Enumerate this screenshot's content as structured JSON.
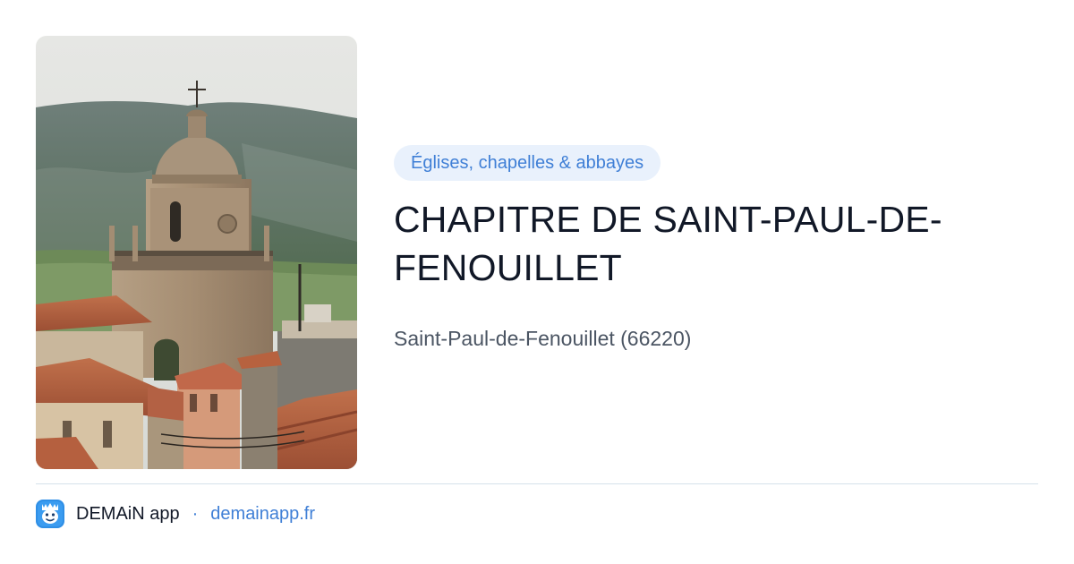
{
  "card": {
    "photo": {
      "subject": "photo-church-bell-tower-terracotta-roofs"
    },
    "category": "Églises, chapelles & abbayes",
    "title": "CHAPITRE DE SAINT-PAUL-DE-FENOUILLET",
    "location": "Saint-Paul-de-Fenouillet (66220)"
  },
  "footer": {
    "logo_icon": "demain-app-logo-icon",
    "app_name": "DEMAiN app",
    "separator": "·",
    "url": "demainapp.fr"
  },
  "colors": {
    "accent": "#3f7fd6",
    "badge_bg": "#e9f1fc",
    "title": "#111827",
    "subtitle": "#4b5563",
    "divider": "#d5e1ea"
  }
}
